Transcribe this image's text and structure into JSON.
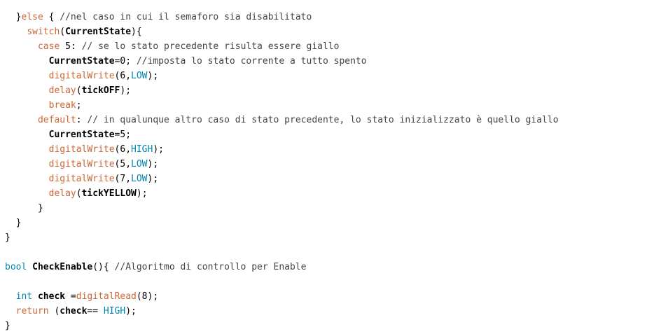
{
  "colors": {
    "background": "#ffffff",
    "keyword": "#cc6633",
    "function": "#cc6633",
    "constant": "#0086b3",
    "type": "#0086b3",
    "text": "#000000",
    "comment": "#444444"
  },
  "lines": [
    [
      [
        "text",
        "  }"
      ],
      [
        "kw",
        "else"
      ],
      [
        "text",
        " { "
      ],
      [
        "comment",
        "//nel caso in cui il semaforo sia disabilitato"
      ]
    ],
    [
      [
        "text",
        "    "
      ],
      [
        "kw",
        "switch"
      ],
      [
        "text",
        "("
      ],
      [
        "id",
        "CurrentState"
      ],
      [
        "text",
        "){"
      ]
    ],
    [
      [
        "text",
        "      "
      ],
      [
        "kw",
        "case"
      ],
      [
        "text",
        " 5: "
      ],
      [
        "comment",
        "// se lo stato precedente risulta essere giallo"
      ]
    ],
    [
      [
        "text",
        "        "
      ],
      [
        "id",
        "CurrentState"
      ],
      [
        "text",
        "=0; "
      ],
      [
        "comment",
        "//imposta lo stato corrente a tutto spento"
      ]
    ],
    [
      [
        "text",
        "        "
      ],
      [
        "fn",
        "digitalWrite"
      ],
      [
        "text",
        "(6,"
      ],
      [
        "const",
        "LOW"
      ],
      [
        "text",
        ");"
      ]
    ],
    [
      [
        "text",
        "        "
      ],
      [
        "fn",
        "delay"
      ],
      [
        "text",
        "("
      ],
      [
        "id",
        "tickOFF"
      ],
      [
        "text",
        ");"
      ]
    ],
    [
      [
        "text",
        "        "
      ],
      [
        "kw",
        "break"
      ],
      [
        "text",
        ";"
      ]
    ],
    [
      [
        "text",
        "      "
      ],
      [
        "kw",
        "default"
      ],
      [
        "text",
        ": "
      ],
      [
        "comment",
        "// in qualunque altro caso di stato precedente, lo stato inizializzato è quello giallo"
      ]
    ],
    [
      [
        "text",
        "        "
      ],
      [
        "id",
        "CurrentState"
      ],
      [
        "text",
        "=5;"
      ]
    ],
    [
      [
        "text",
        "        "
      ],
      [
        "fn",
        "digitalWrite"
      ],
      [
        "text",
        "(6,"
      ],
      [
        "const",
        "HIGH"
      ],
      [
        "text",
        ");"
      ]
    ],
    [
      [
        "text",
        "        "
      ],
      [
        "fn",
        "digitalWrite"
      ],
      [
        "text",
        "(5,"
      ],
      [
        "const",
        "LOW"
      ],
      [
        "text",
        ");"
      ]
    ],
    [
      [
        "text",
        "        "
      ],
      [
        "fn",
        "digitalWrite"
      ],
      [
        "text",
        "(7,"
      ],
      [
        "const",
        "LOW"
      ],
      [
        "text",
        ");"
      ]
    ],
    [
      [
        "text",
        "        "
      ],
      [
        "fn",
        "delay"
      ],
      [
        "text",
        "("
      ],
      [
        "id",
        "tickYELLOW"
      ],
      [
        "text",
        ");"
      ]
    ],
    [
      [
        "text",
        "      }"
      ]
    ],
    [
      [
        "text",
        "  }"
      ]
    ],
    [
      [
        "text",
        "}"
      ]
    ],
    [],
    [
      [
        "type",
        "bool"
      ],
      [
        "text",
        " "
      ],
      [
        "id",
        "CheckEnable"
      ],
      [
        "text",
        "(){ "
      ],
      [
        "comment",
        "//Algoritmo di controllo per Enable"
      ]
    ],
    [],
    [
      [
        "text",
        "  "
      ],
      [
        "type",
        "int"
      ],
      [
        "text",
        " "
      ],
      [
        "id",
        "check"
      ],
      [
        "text",
        " ="
      ],
      [
        "fn",
        "digitalRead"
      ],
      [
        "text",
        "(8);"
      ]
    ],
    [
      [
        "text",
        "  "
      ],
      [
        "kw",
        "return"
      ],
      [
        "text",
        " ("
      ],
      [
        "id",
        "check"
      ],
      [
        "text",
        "== "
      ],
      [
        "const",
        "HIGH"
      ],
      [
        "text",
        ");"
      ]
    ],
    [
      [
        "text",
        "}"
      ]
    ]
  ]
}
